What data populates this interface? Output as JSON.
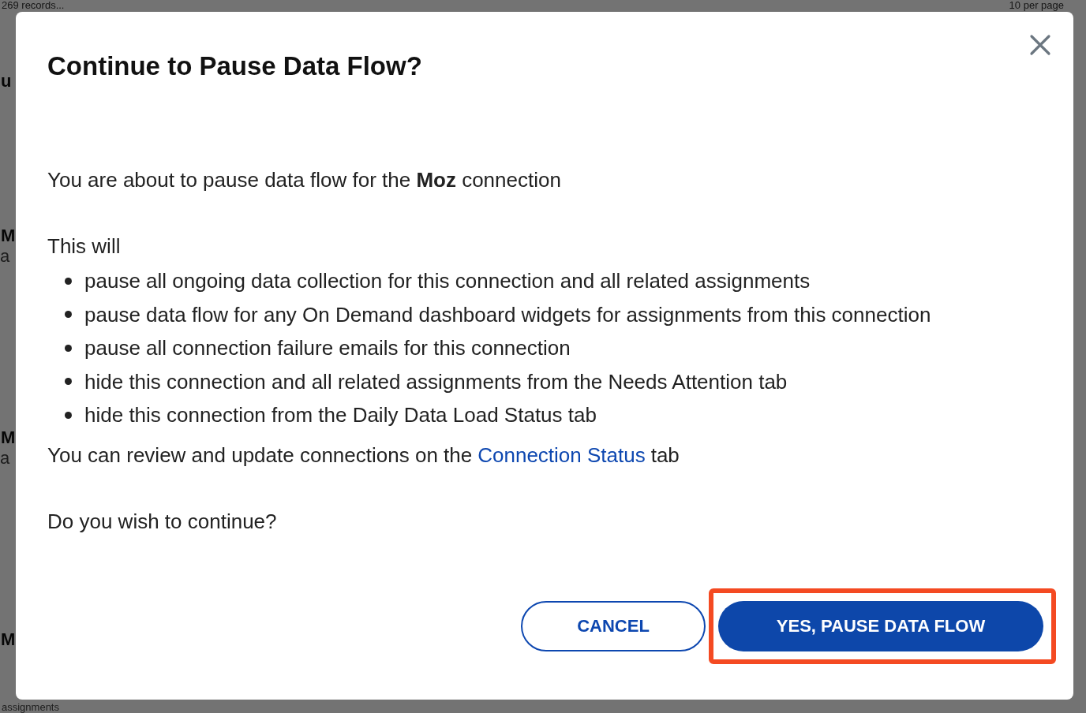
{
  "background": {
    "records": "269 records...",
    "per_page": "10 per page",
    "fragments": [
      {
        "text": "u",
        "kind": "title"
      },
      {
        "text": "M",
        "kind": "title"
      },
      {
        "text": "a",
        "kind": "sub"
      },
      {
        "text": "M",
        "kind": "title"
      },
      {
        "text": "a",
        "kind": "sub"
      },
      {
        "text": "M",
        "kind": "title"
      },
      {
        "text": "assignments",
        "kind": "sub"
      }
    ]
  },
  "dialog": {
    "title": "Continue to Pause Data Flow?",
    "intro": "You are about to pause data flow for the **Moz** connection",
    "list_heading": "This will",
    "items": [
      "pause all ongoing data collection for this connection and all related assignments",
      "pause data flow for any On Demand dashboard widgets for assignments from this connection",
      "pause all connection failure emails for this connection",
      "hide this connection and all related assignments from the Needs Attention tab",
      "hide this connection from the Daily Data Load Status tab"
    ],
    "review": {
      "before": "You can review and update connections on the",
      "link": "Connection Status",
      "after": "tab"
    },
    "question": "Do you wish to continue?",
    "buttons": [
      {
        "label": "CANCEL",
        "kind": "secondary",
        "highlighted": false
      },
      {
        "label": "YES, PAUSE DATA FLOW",
        "kind": "primary",
        "highlighted": true
      }
    ]
  }
}
